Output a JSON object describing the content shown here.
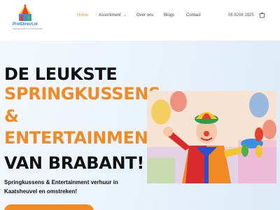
{
  "brand": {
    "name": "PretDirect.nl",
    "tagline": "Springkussens en entertainment"
  },
  "nav": {
    "items": [
      {
        "label": "Home",
        "active": true
      },
      {
        "label": "Assortiment",
        "has_dropdown": true
      },
      {
        "label": "Over ons"
      },
      {
        "label": "Blogs"
      },
      {
        "label": "Contact"
      }
    ],
    "phone": "06 8206 1825",
    "cart_icon": "basket-icon"
  },
  "hero": {
    "lines": [
      "DE LEUKSTE",
      "SPRINGKUSSENS",
      "&",
      "ENTERTAINMENT",
      "VAN BRABANT!"
    ],
    "subtext": "Springkussens & Entertainment verhuur in Kaatsheuvel en omstreken!",
    "image_alt": "clown-with-balloon-animal",
    "colors": {
      "accent": "#f28a24",
      "text": "#111111",
      "nav_active": "#f28a24"
    }
  }
}
